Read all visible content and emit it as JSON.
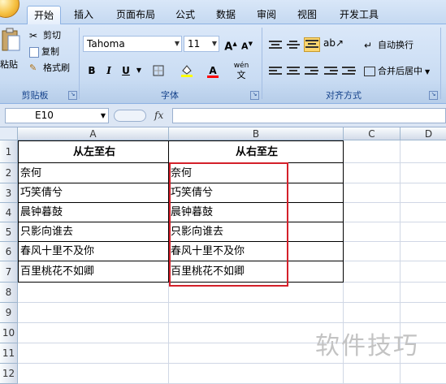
{
  "tabs": [
    "开始",
    "插入",
    "页面布局",
    "公式",
    "数据",
    "审阅",
    "视图",
    "开发工具"
  ],
  "clipboard": {
    "paste_label": "粘贴",
    "cut_label": "剪切",
    "copy_label": "复制",
    "format_painter_label": "格式刷",
    "group_label": "剪贴板"
  },
  "font": {
    "font_name": "Tahoma",
    "font_size": "11",
    "bold_label": "B",
    "italic_label": "I",
    "underline_label": "U",
    "phonetic_label": "wén",
    "font_color_letter": "A",
    "fill_color": "#ffff00",
    "font_color": "#ff0000",
    "group_label": "字体"
  },
  "alignment": {
    "wrap_label": "自动换行",
    "merge_label": "合并后居中",
    "group_label": "对齐方式"
  },
  "formula_bar": {
    "name_box": "E10",
    "fx_label": "fx",
    "formula": ""
  },
  "columns": [
    "A",
    "B",
    "C",
    "D"
  ],
  "rows": [
    "1",
    "2",
    "3",
    "4",
    "5",
    "6",
    "7",
    "8",
    "9",
    "10",
    "11",
    "12"
  ],
  "table": {
    "header_a": "从左至右",
    "header_b": "从右至左",
    "col_a": [
      "奈何",
      "巧笑倩兮",
      "晨钟暮鼓",
      "只影向谁去",
      "春风十里不及你",
      "百里桃花不如卿"
    ],
    "col_b": [
      "奈何",
      "巧笑倩兮",
      "晨钟暮鼓",
      "只影向谁去",
      "春风十里不及你",
      "百里桃花不如卿"
    ]
  },
  "watermark": "软件技巧",
  "highlight_color": "#d4202a"
}
